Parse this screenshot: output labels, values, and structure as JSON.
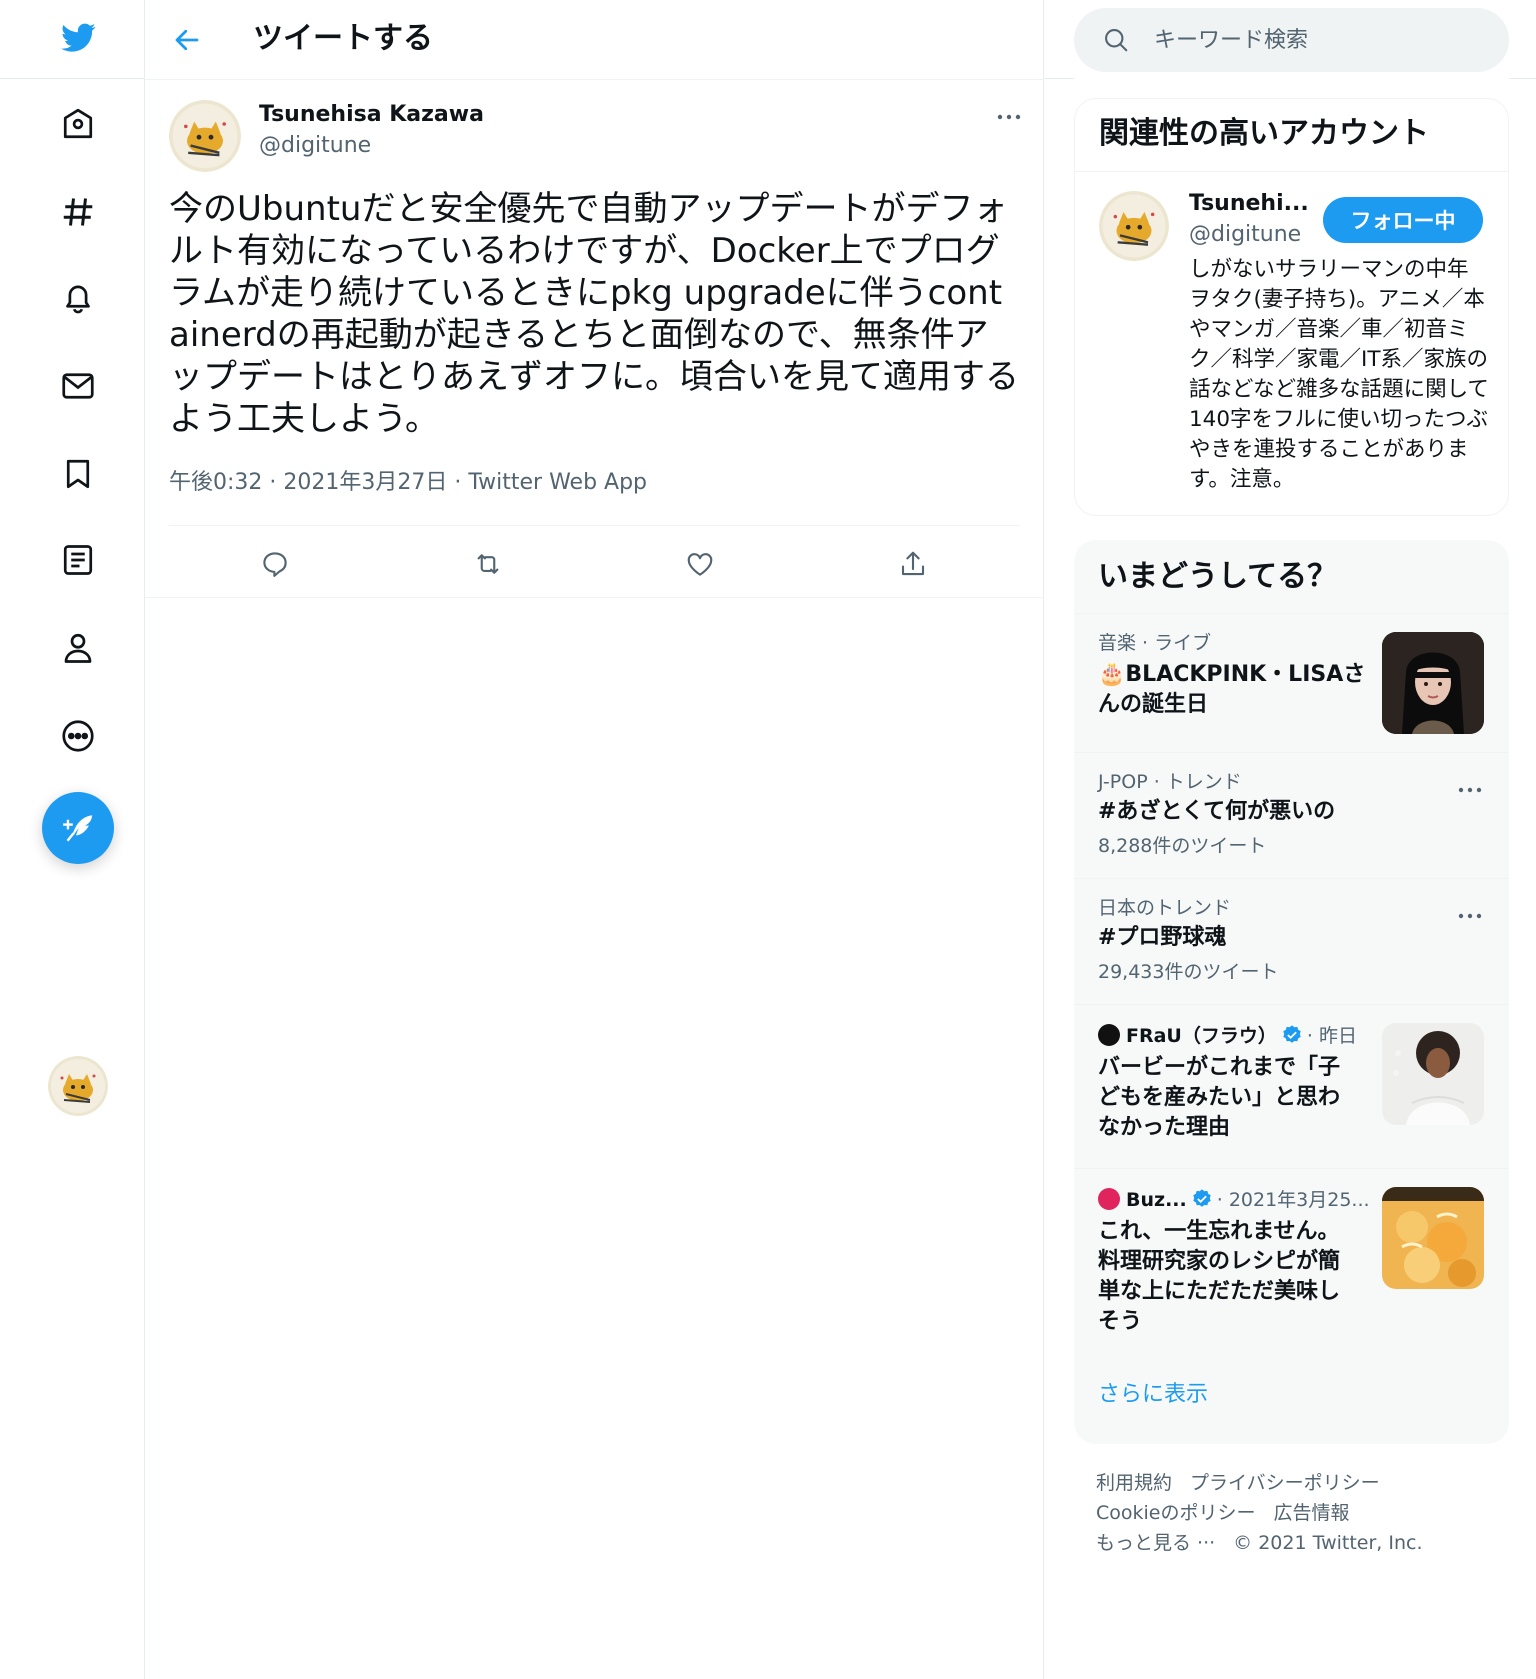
{
  "nav": {
    "icons": [
      "twitter-bird-icon",
      "home-icon",
      "explore-hashtag-icon",
      "notifications-bell-icon",
      "messages-envelope-icon",
      "bookmark-icon",
      "lists-icon",
      "profile-icon",
      "more-circle-icon"
    ],
    "compose_icon": "compose-feather-icon"
  },
  "header": {
    "back_icon": "back-arrow-icon",
    "title": "ツイートする"
  },
  "tweet": {
    "author_name": "Tsunehisa Kazawa",
    "author_handle": "@digitune",
    "text": "今のUbuntuだと安全優先で自動アップデートがデフォルト有効になっているわけですが、Docker上でプログラムが走り続けているときにpkg upgradeに伴うcontainerdの再起動が起きるとちと面倒なので、無条件アップデートはとりあえずオフに。頃合いを見て適用するよう工夫しよう。",
    "time": "午後0:32",
    "date": "2021年3月27日",
    "source": "Twitter Web App",
    "dot": " · ",
    "actions": [
      "reply-icon",
      "retweet-icon",
      "like-heart-icon",
      "share-icon"
    ]
  },
  "search": {
    "placeholder": "キーワード検索"
  },
  "relevant": {
    "title": "関連性の高いアカウント",
    "name": "Tsunehi...",
    "handle": "@digitune",
    "follow_label": "フォロー中",
    "bio": "しがないサラリーマンの中年ヲタク(妻子持ち)。アニメ／本やマンガ／音楽／車／初音ミク／科学／家電／IT系／家族の話などなど雑多な話題に関して140字をフルに使い切ったつぶやきを連投することがあります。注意。"
  },
  "trends": {
    "title": "いまどうしてる？",
    "items": [
      {
        "category": "音楽 · ライブ",
        "title_emoji": "🎂",
        "title": "BLACKPINK・LISAさんの誕生日"
      },
      {
        "category": "J-POP · トレンド",
        "title": "#あざとくて何が悪いの",
        "count": "8,288件のツイート"
      },
      {
        "category": "日本のトレンド",
        "title": "#プロ野球魂",
        "count": "29,433件のツイート"
      },
      {
        "source": "FRaU（フラウ）",
        "time": "· 昨日",
        "title": "バービーがこれまで「子どもを産みたい」と思わなかった理由"
      },
      {
        "source": "Buz...",
        "time": "· 2021年3月25...",
        "title": "これ、一生忘れません。料理研究家のレシピが簡単な上にただただ美味しそう"
      }
    ],
    "show_more": "さらに表示"
  },
  "footer": {
    "links": [
      "利用規約",
      "プライバシーポリシー",
      "Cookieのポリシー",
      "広告情報",
      "もっと見る ···"
    ],
    "copyright": "© 2021 Twitter, Inc."
  },
  "colors": {
    "accent": "#1d9bf0",
    "text": "#0f1419",
    "secondary": "#536471",
    "border": "#eff3f4"
  }
}
